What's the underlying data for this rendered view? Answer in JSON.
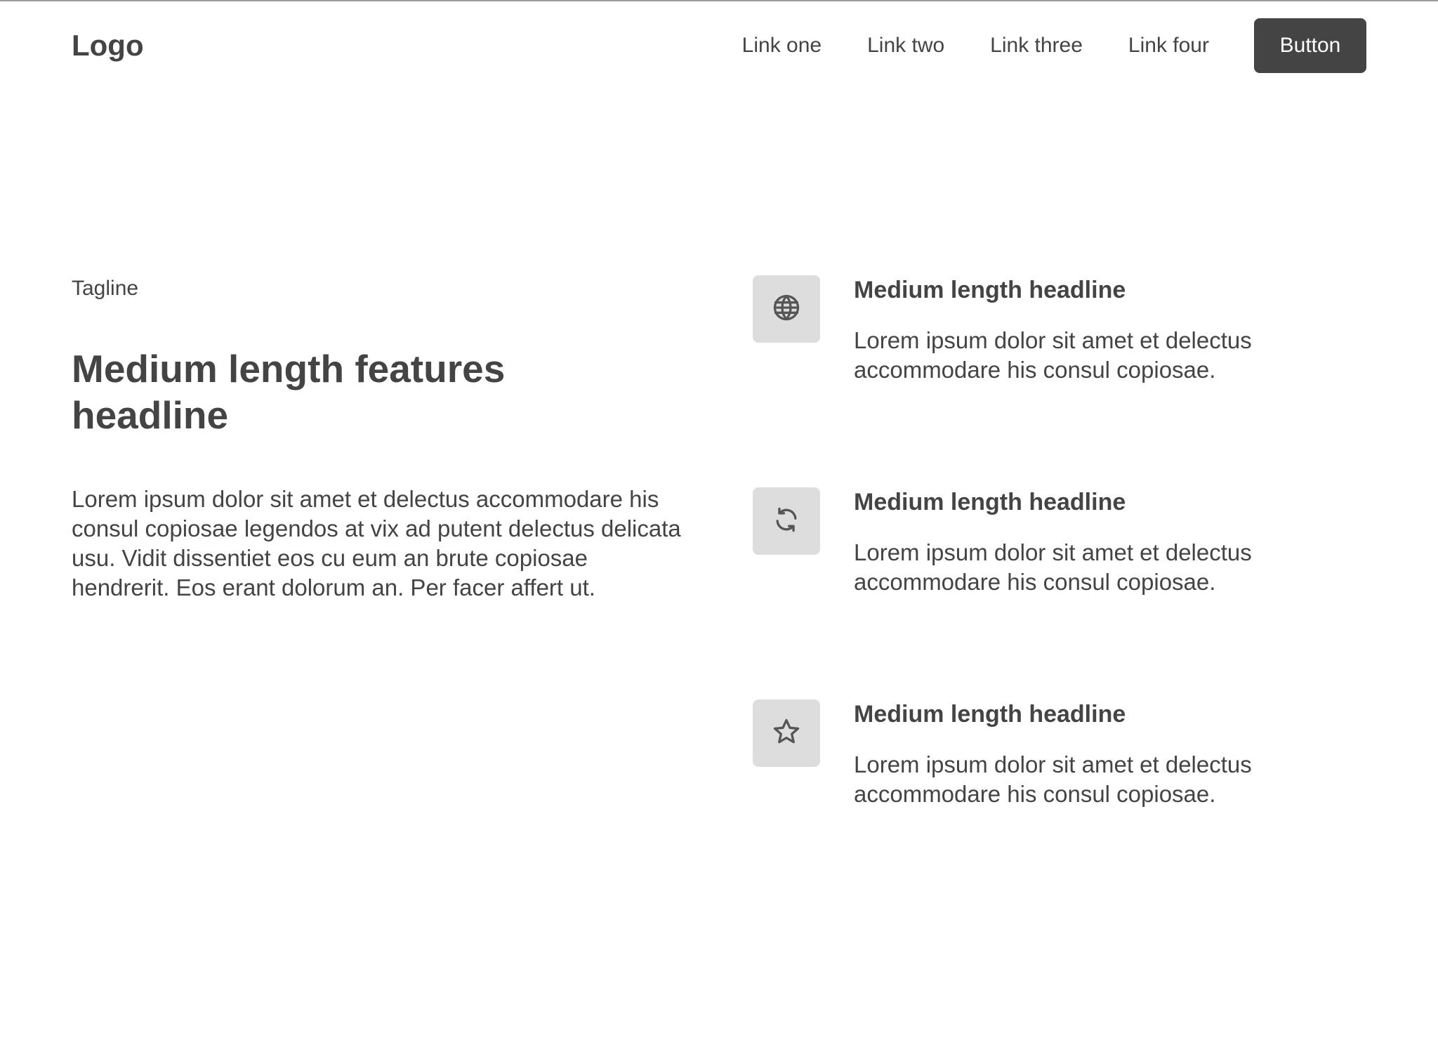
{
  "navbar": {
    "logo": "Logo",
    "links": [
      "Link one",
      "Link two",
      "Link three",
      "Link four"
    ],
    "button_label": "Button"
  },
  "hero": {
    "tagline": "Tagline",
    "headline": "Medium length features headline",
    "body": "Lorem ipsum dolor sit amet et delectus accommodare his consul copiosae legendos at vix ad putent delectus delicata usu. Vidit dissentiet eos cu eum an brute copiosae hendrerit. Eos erant dolorum an. Per facer affert ut."
  },
  "features": [
    {
      "icon": "globe-icon",
      "title": "Medium length headline",
      "description": "Lorem ipsum dolor sit amet et delectus accommodare his consul copiosae."
    },
    {
      "icon": "refresh-icon",
      "title": "Medium length headline",
      "description": "Lorem ipsum dolor sit amet et delectus accommodare his consul copiosae."
    },
    {
      "icon": "star-icon",
      "title": "Medium length headline",
      "description": "Lorem ipsum dolor sit amet et delectus accommodare his consul copiosae."
    }
  ],
  "colors": {
    "text": "#444444",
    "button_bg": "#444444",
    "button_text": "#ffffff",
    "icon_box_bg": "#dddddd",
    "icon_stroke": "#555555",
    "background": "#ffffff"
  }
}
